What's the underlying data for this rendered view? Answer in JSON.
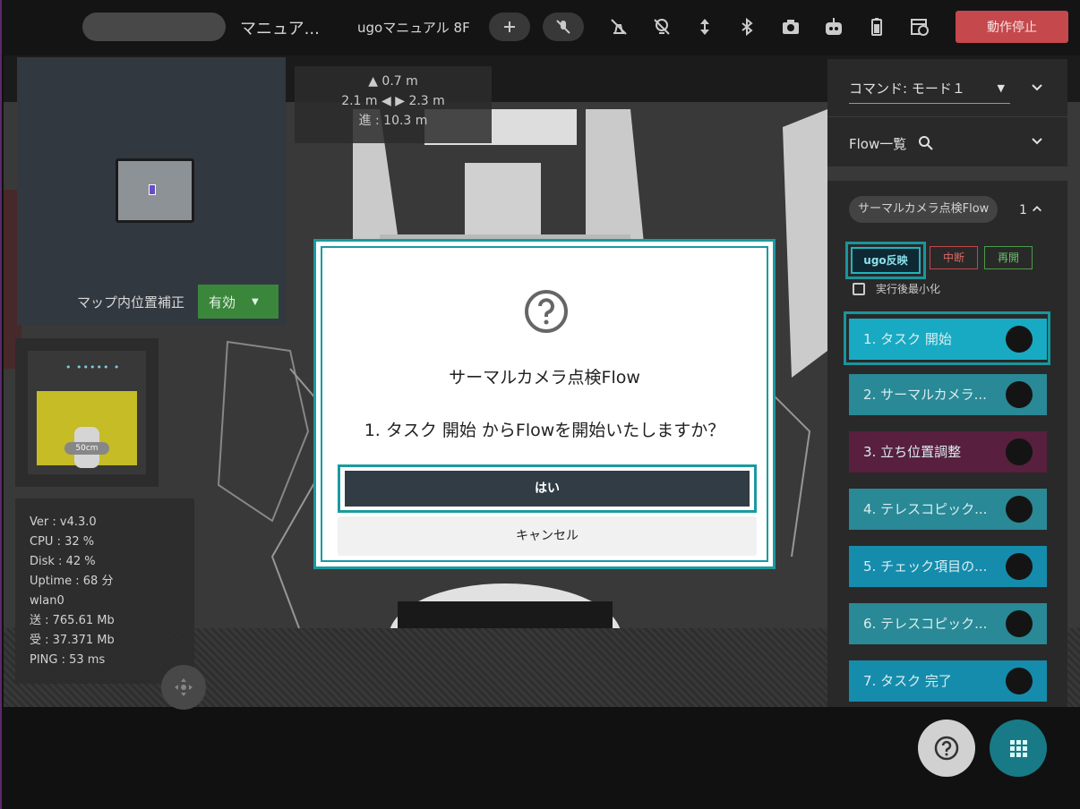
{
  "topbar": {
    "title": "マニュア...",
    "robot_name": "ugoマニュアル 8F",
    "stop_label": "動作停止",
    "icons": [
      "add-icon",
      "mic-off-icon",
      "light-off-icon",
      "lightbulb-off-icon",
      "vertical-arrows-icon",
      "bluetooth-icon",
      "camera-icon",
      "robot-icon",
      "battery-icon",
      "schedule-icon"
    ]
  },
  "map": {
    "position_correction_label": "マップ内位置補正",
    "toggle_value": "有効"
  },
  "distance": {
    "front": "▲ 0.7 m",
    "sides": "2.1 m ◀ ▶ 2.3 m",
    "progress": "進 : 10.3 m"
  },
  "obstacle": {
    "range_label": "50cm"
  },
  "stats": {
    "ver": "Ver : v4.3.0",
    "cpu": "CPU : 32 %",
    "disk": "Disk : 42 %",
    "uptime": "Uptime : 68 分",
    "iface": "wlan0",
    "sent": "送 : 765.61 Mb",
    "recv": "受 : 37.371 Mb",
    "ping": "PING : 53 ms"
  },
  "command": {
    "select_value": "コマンド: モード１",
    "flow_list_label": "Flow一覧"
  },
  "flow": {
    "name": "サーマルカメラ点検Flow",
    "count": "1",
    "ugo_button": "ugo反映",
    "pause_button": "中断",
    "resume_button": "再開",
    "minimize_label": "実行後最小化",
    "tasks": [
      {
        "label": "1. タスク 開始",
        "color": "#19aec6"
      },
      {
        "label": "2. サーマルカメラ...",
        "color": "#2a8c9a"
      },
      {
        "label": "3. 立ち位置調整",
        "color": "#5a2040"
      },
      {
        "label": "4. テレスコピック...",
        "color": "#2a8c9a"
      },
      {
        "label": "5. チェック項目の...",
        "color": "#168fb0"
      },
      {
        "label": "6. テレスコピック...",
        "color": "#2a8c9a"
      },
      {
        "label": "7. タスク 完了",
        "color": "#168fb0"
      }
    ]
  },
  "dialog": {
    "title": "サーマルカメラ点検Flow",
    "message": "1. タスク 開始 からFlowを開始いたしますか？",
    "yes_label": "はい",
    "cancel_label": "キャンセル"
  },
  "colors": {
    "accent": "#1a9aa0",
    "stop": "#c94a4f",
    "toggle_green": "#3c8a3e"
  }
}
